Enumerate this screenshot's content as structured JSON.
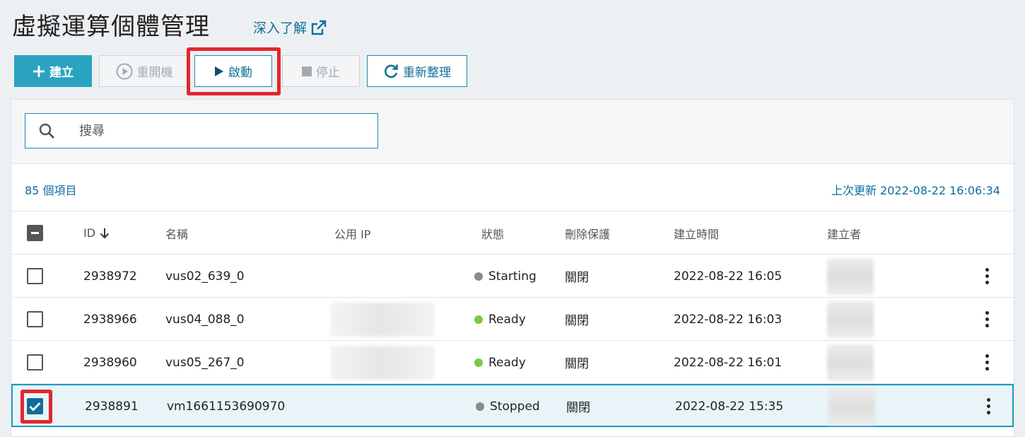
{
  "page": {
    "title": "虛擬運算個體管理",
    "learn_more": "深入了解"
  },
  "toolbar": {
    "create_label": "建立",
    "restart_label": "重開機",
    "start_label": "啟動",
    "stop_label": "停止",
    "refresh_label": "重新整理"
  },
  "search": {
    "placeholder": "搜尋"
  },
  "summary": {
    "item_count": "85 個項目",
    "last_update": "上次更新 2022-08-22 16:06:34"
  },
  "table": {
    "columns": {
      "id": "ID",
      "name": "名稱",
      "public_ip": "公用 IP",
      "status": "狀態",
      "delete_protection": "刪除保護",
      "created_time": "建立時間",
      "creator": "建立者"
    },
    "rows": [
      {
        "id": "2938972",
        "name": "vus02_639_0",
        "status": "Starting",
        "status_color": "#8a8a8a",
        "delete_protection": "關閉",
        "created_time": "2022-08-22 16:05",
        "checked": false
      },
      {
        "id": "2938966",
        "name": "vus04_088_0",
        "status": "Ready",
        "status_color": "#7ac943",
        "delete_protection": "關閉",
        "created_time": "2022-08-22 16:03",
        "checked": false
      },
      {
        "id": "2938960",
        "name": "vus05_267_0",
        "status": "Ready",
        "status_color": "#7ac943",
        "delete_protection": "關閉",
        "created_time": "2022-08-22 16:01",
        "checked": false
      },
      {
        "id": "2938891",
        "name": "vm1661153690970",
        "status": "Stopped",
        "status_color": "#8a8a8a",
        "delete_protection": "關閉",
        "created_time": "2022-08-22 15:35",
        "checked": true
      }
    ]
  },
  "colors": {
    "accent": "#0d6e9b",
    "primary_button": "#2aa3c0",
    "highlight": "#e3262e",
    "selected_row": "#e8f4f8"
  }
}
